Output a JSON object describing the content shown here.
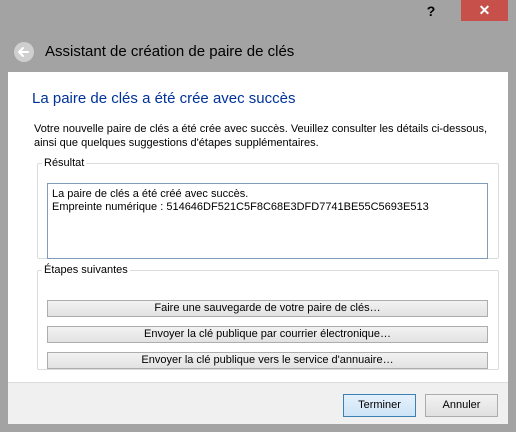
{
  "titlebar": {
    "help_label": "?",
    "close_label": "✕"
  },
  "header": {
    "back_icon": "back-arrow-icon",
    "title": "Assistant de création de paire de clés"
  },
  "page": {
    "title": "La paire de clés a été crée avec succès",
    "description": "Votre nouvelle paire de clés a été crée avec succès. Veuillez consulter les détails ci-dessous, ainsi que quelques suggestions d'étapes supplémentaires."
  },
  "result": {
    "legend": "Résultat",
    "line1": "La paire de clés a été créé avec succès.",
    "line2": "Empreinte numérique : 514646DF521C5F8C68E3DFD7741BE55C5693E513"
  },
  "steps": {
    "legend": "Étapes suivantes",
    "backup": "Faire une sauvegarde de votre paire de clés…",
    "email": "Envoyer la clé publique par courrier électronique…",
    "directory": "Envoyer la clé publique vers le service d'annuaire…"
  },
  "footer": {
    "finish": "Terminer",
    "cancel": "Annuler"
  },
  "colors": {
    "title_blue": "#003399",
    "close_red": "#c7514a",
    "chrome_gray": "#a3a3a3"
  }
}
